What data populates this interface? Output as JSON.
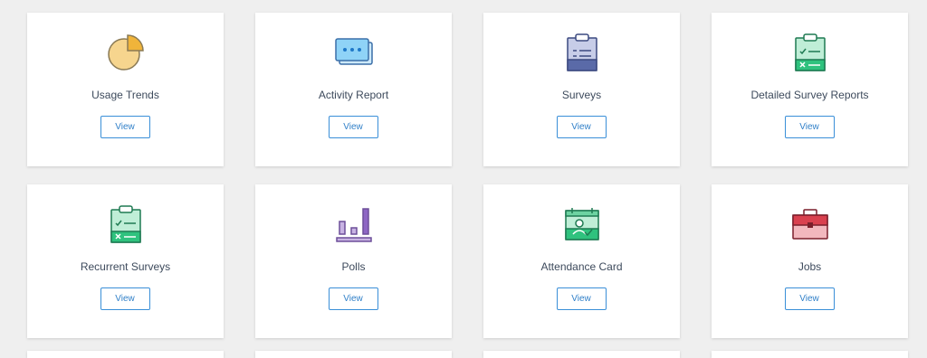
{
  "cards": [
    {
      "title": "Usage Trends",
      "button": "View",
      "icon": "pie-chart-icon"
    },
    {
      "title": "Activity Report",
      "button": "View",
      "icon": "chat-bubbles-icon"
    },
    {
      "title": "Surveys",
      "button": "View",
      "icon": "clipboard-icon"
    },
    {
      "title": "Detailed Survey Reports",
      "button": "View",
      "icon": "clipboard-checklist-icon"
    },
    {
      "title": "Recurrent Surveys",
      "button": "View",
      "icon": "clipboard-checklist-icon"
    },
    {
      "title": "Polls",
      "button": "View",
      "icon": "bar-chart-icon"
    },
    {
      "title": "Attendance Card",
      "button": "View",
      "icon": "attendance-card-icon"
    },
    {
      "title": "Jobs",
      "button": "View",
      "icon": "briefcase-icon"
    }
  ],
  "colors": {
    "background": "#efefef",
    "card": "#ffffff",
    "button_border": "#3a8fd8",
    "title_text": "#3d4a5c"
  }
}
